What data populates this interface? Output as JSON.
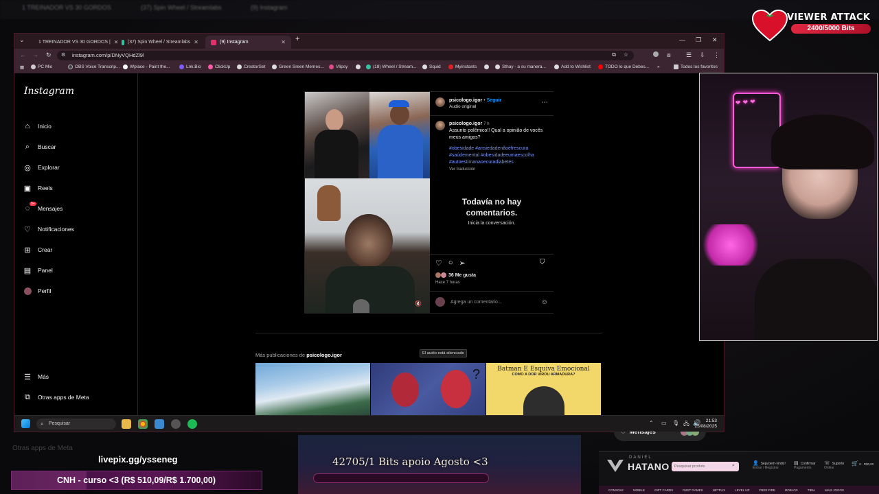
{
  "background_tabs": [
    "1 TREINADOR VS 30 GORDOS",
    "(37) Spin Wheel / Streamlabs",
    "(9) Instagram"
  ],
  "browser": {
    "tabs": [
      {
        "label": "1 TREINADOR VS 30 GORDOS |",
        "color": "#ff0000"
      },
      {
        "label": "(37) Spin Wheel / Streamlabs",
        "color": "#31c3a2"
      },
      {
        "label": "(9) Instagram",
        "color": "#e1306c"
      }
    ],
    "url": "instagram.com/p/DNyVQHdZl9l",
    "bookmarks": [
      "PC Mio",
      "OBS Voice Transcrip...",
      "Wplace - Paint the...",
      "Lnk.Bio",
      "ClickUp",
      "CreatorSet",
      "Green Sreen Memes...",
      "Vlipsy",
      "(18) Wheel / Stream...",
      "Squid",
      "Myinstants",
      "Sthay - a su manera...",
      "Add to Wishlist",
      "TODO lo que Debes...",
      "Todos los favoritos"
    ]
  },
  "instagram": {
    "logo": "Instagram",
    "nav": [
      {
        "label": "Inicio",
        "icon": "home-icon"
      },
      {
        "label": "Buscar",
        "icon": "search-icon"
      },
      {
        "label": "Explorar",
        "icon": "compass-icon"
      },
      {
        "label": "Reels",
        "icon": "reels-icon"
      },
      {
        "label": "Mensajes",
        "icon": "messenger-icon",
        "badge": "9+"
      },
      {
        "label": "Notificaciones",
        "icon": "heart-icon"
      },
      {
        "label": "Crear",
        "icon": "plus-icon"
      },
      {
        "label": "Panel",
        "icon": "chart-icon"
      },
      {
        "label": "Perfil",
        "icon": "avatar-icon"
      }
    ],
    "nav_bottom": [
      {
        "label": "Más",
        "icon": "menu-icon"
      },
      {
        "label": "Otras apps de Meta",
        "icon": "meta-apps-icon"
      }
    ],
    "post": {
      "username": "psicologo.igor",
      "follow": "Seguir",
      "separator": "•",
      "audio": "Audio original",
      "time_short": "7 h",
      "caption": "Assunto polêmico!! Qual a opinião de vocês meus amigos?",
      "hashtags": [
        "#obesidade",
        "#ansiedadenãoéfrescura",
        "#saúdemental",
        "#obesidadeeumaescolha",
        "#autoestimanaoecuradiabetes"
      ],
      "translate": "Ver traducción",
      "no_comments_title": "Todavía no hay comentarios.",
      "no_comments_sub": "Inicia la conversación.",
      "likes": "36 Me gusta",
      "time_ago": "Hace 7 horas",
      "comment_placeholder": "Agrega un comentario...",
      "muted_tooltip": "El audio está silenciado"
    },
    "more_posts_prefix": "Más publicaciones de",
    "more_posts_user": "psicologo.igor",
    "thumb3_title": "Batman E Esquiva Emocional",
    "thumb3_subtitle": "COMO A DOR VIROU ARMADURA?",
    "messages_pill": {
      "label": "Mensajes",
      "badge": "9+"
    }
  },
  "taskbar": {
    "search": "Pesquisar",
    "time": "21:53",
    "date": "25/08/2025"
  },
  "overlay": {
    "viewer_attack_title": "VIEWER ATTACK",
    "viewer_attack_value": "2400/5000 Bits",
    "viewer_attack_progress": 0.48,
    "livepix": "livepix.gg/ysseneg",
    "cnh": "CNH - curso <3 (R$ 510,09/R$ 1.700,00)",
    "cnh_progress": 0.3,
    "bits_goal": "42705/1 Bits apoio Agosto <3",
    "ghost_text": "Otras apps de Meta"
  },
  "ad": {
    "brand_top": "DANIEL",
    "brand": "HATANO",
    "search_placeholder": "Pesquisar produto",
    "links": [
      {
        "title": "Seja bem-vindo!",
        "sub": "Entrar / Registrar"
      },
      {
        "title": "Confirmar",
        "sub": "Pagamento"
      },
      {
        "title": "Suporte",
        "sub": "Online"
      }
    ],
    "cart_count": "0 · R$0,00",
    "menu": [
      "CONSOLE",
      "MOBILE",
      "GIFT CARDS",
      "DIGIT GAMES",
      "NETFLIX",
      "LEVEL UP",
      "FREE FIRE",
      "ROBLOX",
      "TIBIA",
      "MAIS JOGOS"
    ]
  },
  "colors": {
    "accent": "#0095f6",
    "hashtag": "#7b96ff",
    "badge": "#ff3040",
    "window_border": "#4a1a2a"
  }
}
